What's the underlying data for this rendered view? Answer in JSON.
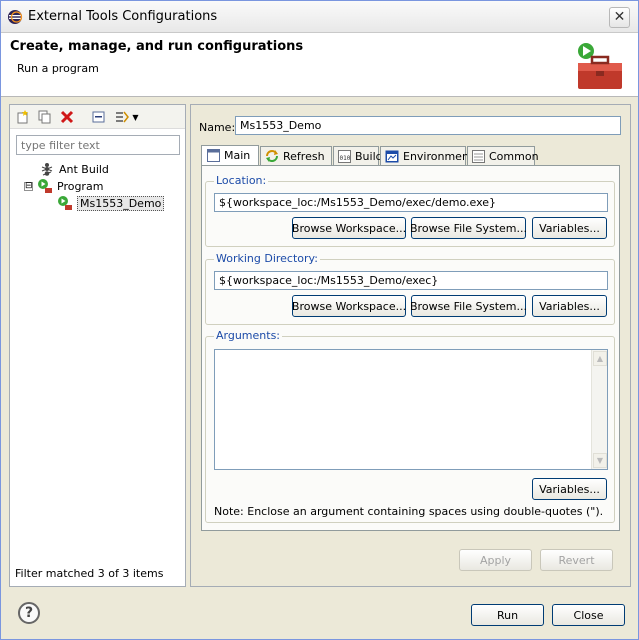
{
  "window": {
    "title": "External Tools Configurations",
    "close_glyph": "✕"
  },
  "banner": {
    "title": "Create, manage, and run configurations",
    "subtitle": "Run a program"
  },
  "left": {
    "filter_placeholder": "type filter text",
    "tree": [
      {
        "label": "Ant Build",
        "icon": "ant-icon"
      },
      {
        "label": "Program",
        "icon": "program-icon",
        "expander": "⊟"
      },
      {
        "label": "Ms1553_Demo",
        "icon": "program-config-icon",
        "selected": true
      }
    ],
    "filter_status": "Filter matched 3 of 3 items"
  },
  "right": {
    "name_label": "Name:",
    "name_value": "Ms1553_Demo",
    "tabs": [
      {
        "label": "Main",
        "active": true
      },
      {
        "label": "Refresh"
      },
      {
        "label": "Build"
      },
      {
        "label": "Environment"
      },
      {
        "label": "Common"
      }
    ],
    "location": {
      "legend": "Location:",
      "value": "${workspace_loc:/Ms1553_Demo/exec/demo.exe}",
      "buttons": [
        "Browse Workspace...",
        "Browse File System...",
        "Variables..."
      ]
    },
    "working_dir": {
      "legend": "Working Directory:",
      "value": "${workspace_loc:/Ms1553_Demo/exec}",
      "buttons": [
        "Browse Workspace...",
        "Browse File System...",
        "Variables..."
      ]
    },
    "arguments": {
      "legend": "Arguments:",
      "value": "",
      "variables_button": "Variables...",
      "note": "Note: Enclose an argument containing spaces using double-quotes (\")."
    },
    "apply_button": "Apply",
    "revert_button": "Revert"
  },
  "footer": {
    "help_glyph": "?",
    "run_button": "Run",
    "close_button": "Close"
  }
}
